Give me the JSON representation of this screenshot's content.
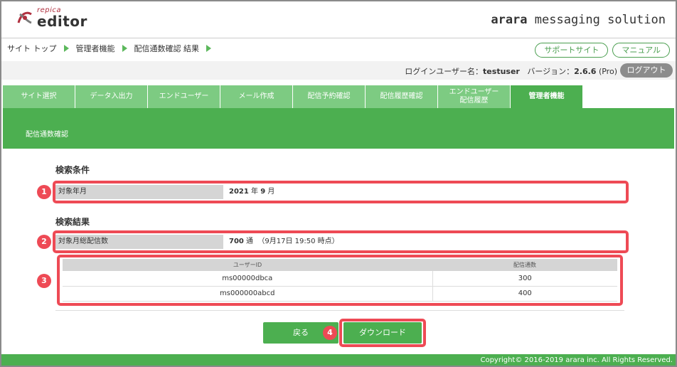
{
  "header": {
    "logo_sub": "repica",
    "logo_main": "editor",
    "brand_bold": "arara",
    "brand_rest": " messaging solution"
  },
  "breadcrumb": [
    "サイト トップ",
    "管理者機能",
    "配信通数確認 結果"
  ],
  "top_buttons": {
    "support": "サポートサイト",
    "manual": "マニュアル"
  },
  "login": {
    "user_label": "ログインユーザー名：",
    "user": "testuser",
    "version_label": "バージョン：",
    "version": "2.6.6",
    "edition": "(Pro)",
    "logout": "ログアウト"
  },
  "tabs": [
    {
      "label": "サイト選択"
    },
    {
      "label": "データ入出力"
    },
    {
      "label": "エンドユーザー"
    },
    {
      "label": "メール作成"
    },
    {
      "label": "配信予約確認"
    },
    {
      "label": "配信履歴確認"
    },
    {
      "label": "エンドユーザー\n配信履歴"
    },
    {
      "label": "管理者機能"
    }
  ],
  "section_title": "配信通数確認",
  "search": {
    "heading": "検索条件",
    "label": "対象年月",
    "year": "2021",
    "year_unit": " 年 ",
    "month": "9",
    "month_unit": " 月"
  },
  "result": {
    "heading": "検索結果",
    "label": "対象月総配信数",
    "count": "700",
    "count_unit": " 通",
    "timestamp": "（9月17日 19:50 時点）",
    "columns": [
      "ユーザーID",
      "配信通数"
    ],
    "rows": [
      [
        "ms00000dbca",
        "300"
      ],
      [
        "ms000000abcd",
        "400"
      ]
    ]
  },
  "buttons": {
    "back": "戻る",
    "download": "ダウンロード"
  },
  "annotations": [
    "1",
    "2",
    "3",
    "4"
  ],
  "footer": "Copyright© 2016-2019 arara inc. All Rights Reserved.",
  "colors": {
    "green": "#4caf50",
    "light_green": "#7dcb82",
    "highlight_red": "#ee4a55",
    "gray_label": "#d5d5d5"
  },
  "icons": [
    "repica-logo-icon",
    "breadcrumb-arrow-icon"
  ]
}
